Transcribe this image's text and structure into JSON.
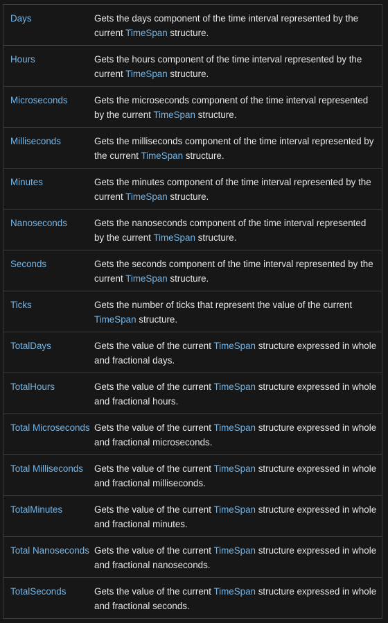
{
  "link_color": "#75b6e7",
  "rows": [
    {
      "name": "Days",
      "desc_before": "Gets the days component of the time interval represented by the current ",
      "link": "TimeSpan",
      "desc_after": " structure."
    },
    {
      "name": "Hours",
      "desc_before": "Gets the hours component of the time interval represented by the current ",
      "link": "TimeSpan",
      "desc_after": " structure."
    },
    {
      "name": "Microseconds",
      "desc_before": "Gets the microseconds component of the time interval represented by the current ",
      "link": "TimeSpan",
      "desc_after": " structure."
    },
    {
      "name": "Milliseconds",
      "desc_before": "Gets the milliseconds component of the time interval represented by the current ",
      "link": "TimeSpan",
      "desc_after": " structure."
    },
    {
      "name": "Minutes",
      "desc_before": "Gets the minutes component of the time interval represented by the current ",
      "link": "TimeSpan",
      "desc_after": " structure."
    },
    {
      "name": "Nanoseconds",
      "desc_before": "Gets the nanoseconds component of the time interval represented by the current ",
      "link": "TimeSpan",
      "desc_after": " structure."
    },
    {
      "name": "Seconds",
      "desc_before": "Gets the seconds component of the time interval represented by the current ",
      "link": "TimeSpan",
      "desc_after": " structure."
    },
    {
      "name": "Ticks",
      "desc_before": "Gets the number of ticks that represent the value of the current ",
      "link": "TimeSpan",
      "desc_after": " structure."
    },
    {
      "name": "TotalDays",
      "desc_before": "Gets the value of the current ",
      "link": "TimeSpan",
      "desc_after": " structure expressed in whole and fractional days."
    },
    {
      "name": "TotalHours",
      "desc_before": "Gets the value of the current ",
      "link": "TimeSpan",
      "desc_after": " structure expressed in whole and fractional hours."
    },
    {
      "name": "Total Microseconds",
      "desc_before": "Gets the value of the current ",
      "link": "TimeSpan",
      "desc_after": " structure expressed in whole and fractional microseconds."
    },
    {
      "name": "Total Milliseconds",
      "desc_before": "Gets the value of the current ",
      "link": "TimeSpan",
      "desc_after": " structure expressed in whole and fractional milliseconds."
    },
    {
      "name": "TotalMinutes",
      "desc_before": "Gets the value of the current ",
      "link": "TimeSpan",
      "desc_after": " structure expressed in whole and fractional minutes."
    },
    {
      "name": "Total Nanoseconds",
      "desc_before": "Gets the value of the current ",
      "link": "TimeSpan",
      "desc_after": " structure expressed in whole and fractional nanoseconds."
    },
    {
      "name": "TotalSeconds",
      "desc_before": "Gets the value of the current ",
      "link": "TimeSpan",
      "desc_after": " structure expressed in whole and fractional seconds."
    }
  ]
}
